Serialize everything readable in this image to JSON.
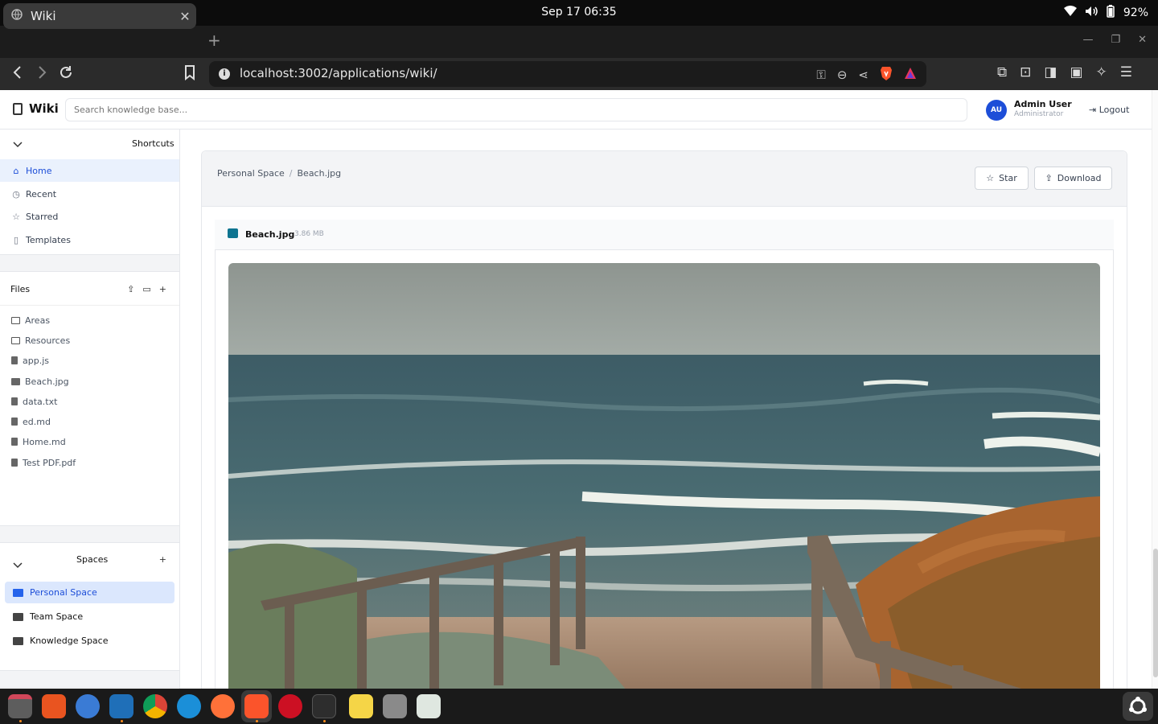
{
  "system": {
    "clock": "Sep 17  06:35",
    "battery": "92%"
  },
  "browser": {
    "tab_title": "Wiki",
    "tab_close": "✕",
    "new_tab": "+",
    "url": "localhost:3002/applications/wiki/"
  },
  "header": {
    "brand": "Wiki",
    "search_placeholder": "Search knowledge base...",
    "user_initials": "AU",
    "user_name": "Admin User",
    "user_role": "Administrator",
    "logout_label": "Logout"
  },
  "sidebar": {
    "shortcuts_title": "Shortcuts",
    "shortcuts": [
      {
        "label": "Home",
        "icon": "home-icon"
      },
      {
        "label": "Recent",
        "icon": "clock-icon"
      },
      {
        "label": "Starred",
        "icon": "star-icon"
      },
      {
        "label": "Templates",
        "icon": "clipboard-icon"
      }
    ],
    "files_title": "Files",
    "files": [
      {
        "label": "Areas",
        "type": "folder"
      },
      {
        "label": "Resources",
        "type": "folder"
      },
      {
        "label": "app.js",
        "type": "file"
      },
      {
        "label": "Beach.jpg",
        "type": "image"
      },
      {
        "label": "data.txt",
        "type": "file"
      },
      {
        "label": "ed.md",
        "type": "file"
      },
      {
        "label": "Home.md",
        "type": "file"
      },
      {
        "label": "Test PDF.pdf",
        "type": "file"
      }
    ],
    "spaces_title": "Spaces",
    "spaces": [
      {
        "label": "Personal Space"
      },
      {
        "label": "Team Space"
      },
      {
        "label": "Knowledge Space"
      }
    ]
  },
  "main": {
    "breadcrumb": [
      "Personal Space",
      "Beach.jpg"
    ],
    "breadcrumb_sep": "/",
    "star_label": "Star",
    "download_label": "Download",
    "file_name": "Beach.jpg",
    "file_size": "3.86 MB"
  },
  "colors": {
    "accent": "#1d4ed8",
    "active_bg": "#eaf1fd"
  }
}
